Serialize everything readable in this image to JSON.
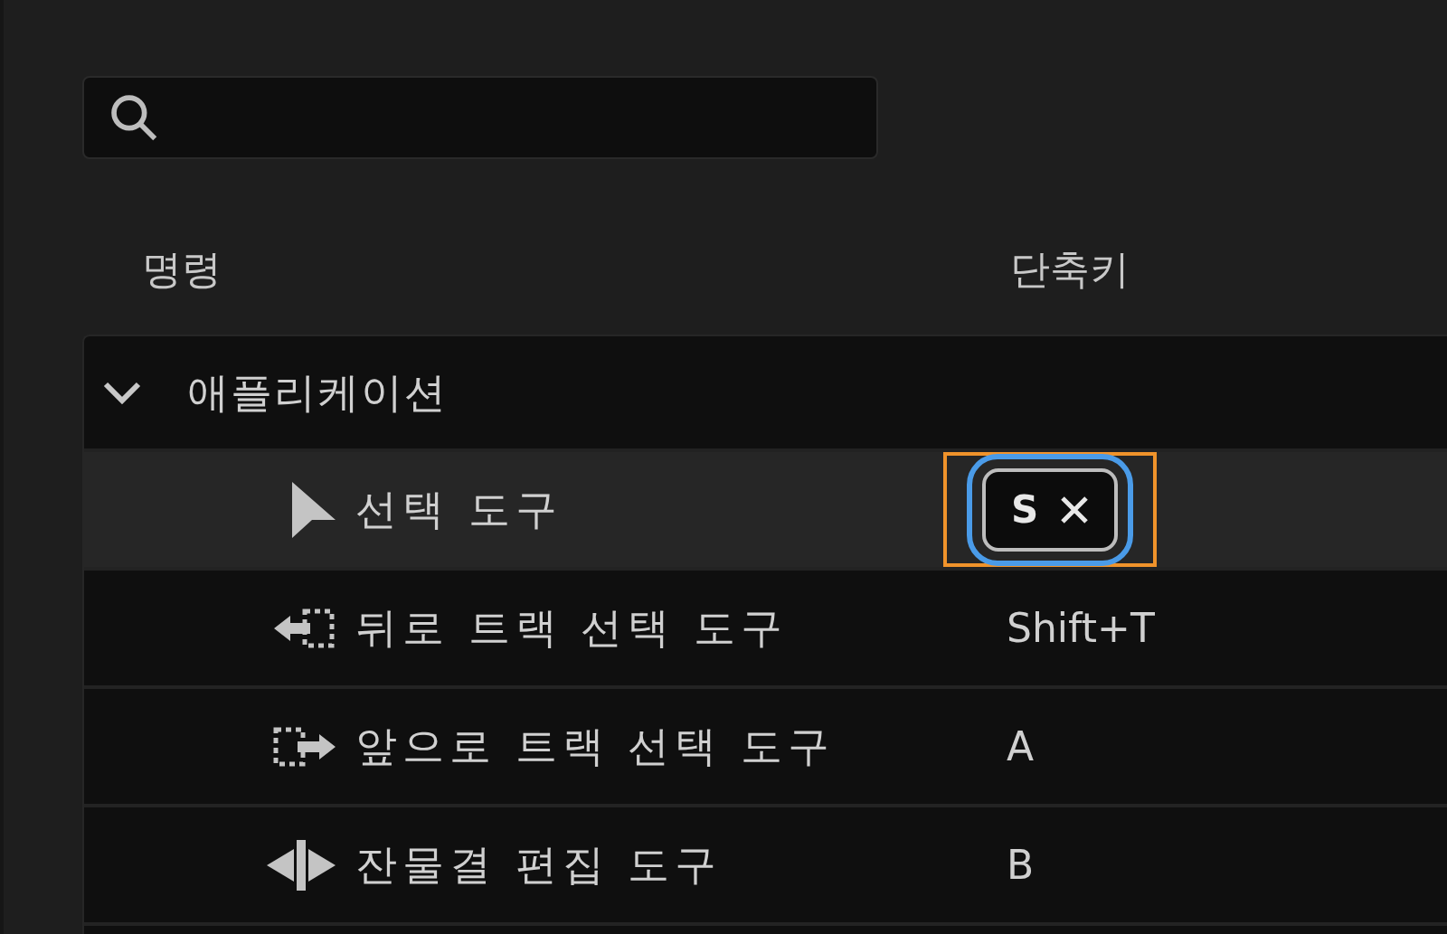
{
  "columns": [
    "명령",
    "단축키"
  ],
  "group": {
    "label": "애플리케이션",
    "expanded": true,
    "rows": [
      {
        "label": "선택 도구",
        "shortcut": "S",
        "selected": true,
        "editing": true
      },
      {
        "label": "뒤로 트랙 선택 도구",
        "shortcut": "Shift+T",
        "selected": false,
        "editing": false
      },
      {
        "label": "앞으로 트랙 선택 도구",
        "shortcut": "A",
        "selected": false,
        "editing": false
      },
      {
        "label": "잔물결 편집 도구",
        "shortcut": "B",
        "selected": false,
        "editing": false
      }
    ]
  }
}
